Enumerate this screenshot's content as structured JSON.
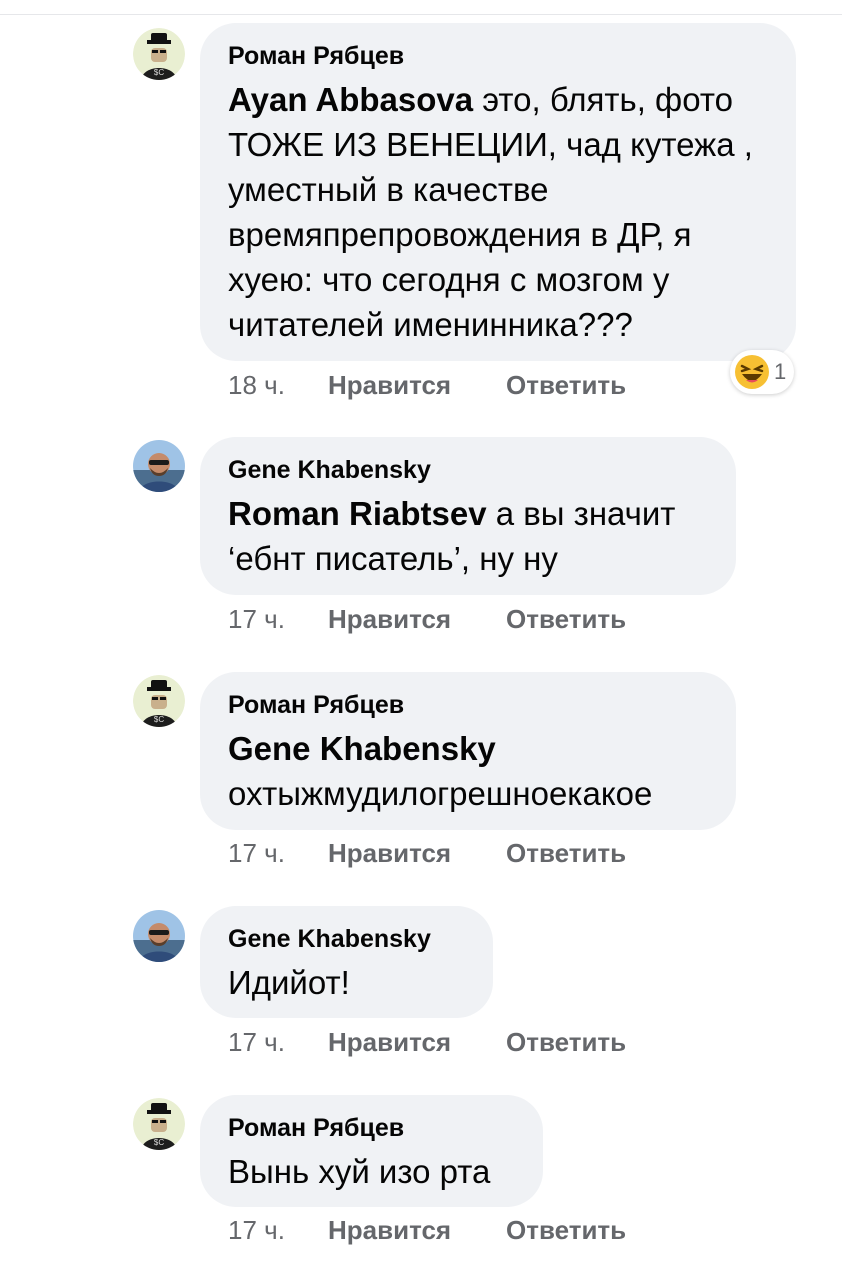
{
  "comments": [
    {
      "author": "Роман Рябцев",
      "mention": "Ayan Abbasova",
      "text": " это, блять, фото ТОЖЕ ИЗ ВЕНЕЦИИ, чад кутежа , уместный в качестве времяпрепровождения в ДР, я хуею: что сегодня с мозгом у читателей именинника???",
      "time": "18 ч.",
      "like": "Нравится",
      "reply": "Ответить",
      "reaction": {
        "icon": "laughing-emoji",
        "count": "1"
      }
    },
    {
      "author": "Gene Khabensky",
      "mention": "Roman Riabtsev",
      "text": " а вы значит ‘ебнт писатель’, ну ну",
      "time": "17 ч.",
      "like": "Нравится",
      "reply": "Ответить"
    },
    {
      "author": "Роман Рябцев",
      "mention": "Gene Khabensky",
      "text": " охтыжмудилогрешноекакое",
      "time": "17 ч.",
      "like": "Нравится",
      "reply": "Ответить"
    },
    {
      "author": "Gene Khabensky",
      "mention": "",
      "text": "Идийот!",
      "time": "17 ч.",
      "like": "Нравится",
      "reply": "Ответить"
    },
    {
      "author": "Роман Рябцев",
      "mention": "",
      "text": "Вынь хуй изо рта",
      "time": "17 ч.",
      "like": "Нравится",
      "reply": "Ответить"
    }
  ],
  "colors": {
    "bubble": "#f0f2f5",
    "text": "#050505",
    "meta": "#65676b"
  }
}
